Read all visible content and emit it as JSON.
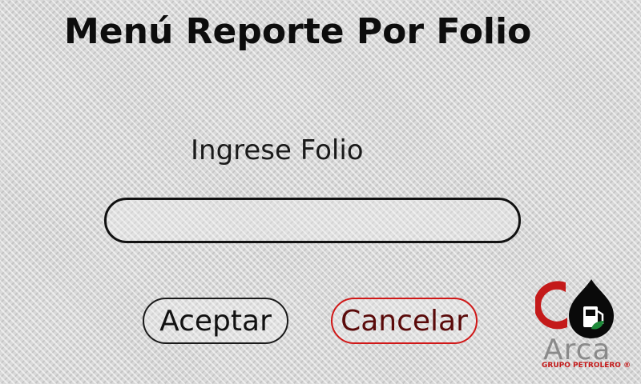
{
  "screen": {
    "title": "Menú Reporte Por Folio",
    "prompt": "Ingrese Folio"
  },
  "folio_input": {
    "value": "",
    "placeholder": ""
  },
  "buttons": {
    "accept_label": "Aceptar",
    "cancel_label": "Cancelar"
  },
  "logo": {
    "name": "Arca",
    "subtitle": "GRUPO PETROLERO ®",
    "icon": "fuel-pump-drop-icon"
  },
  "colors": {
    "title": "#0d0d0d",
    "cancel_border": "#d01818",
    "cancel_text": "#5a0a0a",
    "logo_red": "#c41a1a"
  }
}
